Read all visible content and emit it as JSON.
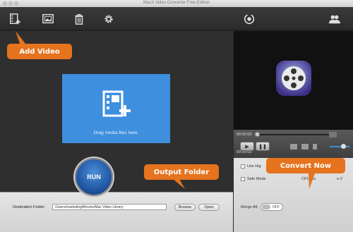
{
  "window": {
    "title": "MacX Video Converter Free Edition"
  },
  "toolbar": {
    "icons": [
      "add-video-icon",
      "add-photo-icon",
      "trash-icon",
      "gear-icon",
      "update-icon",
      "users-icon"
    ]
  },
  "drop_zone": {
    "text": "Drag media files here."
  },
  "player": {
    "time_start": "00:00:00",
    "time_end": "00:00:00"
  },
  "settings": {
    "use_high_label": "Use Hig",
    "safe_mode_label": "Safe Mode",
    "cpu_label": "CPU Co",
    "cpu_value": "e 2",
    "merge_label": "Merge All:",
    "merge_toggle": "OFF"
  },
  "run_button": {
    "label": "RUN"
  },
  "bottom": {
    "dest_label": "Destination Folder:",
    "dest_value": "/Users/marketing/Movies/Mac Video Library",
    "browse_label": "Browse",
    "open_label": "Open"
  },
  "callouts": {
    "add_video": "Add Video",
    "output_folder": "Output Folder",
    "convert_now": "Convert Now"
  },
  "colors": {
    "accent_orange": "#e6731e",
    "drop_blue": "#3e8fde",
    "run_blue": "#1b4f9c"
  }
}
